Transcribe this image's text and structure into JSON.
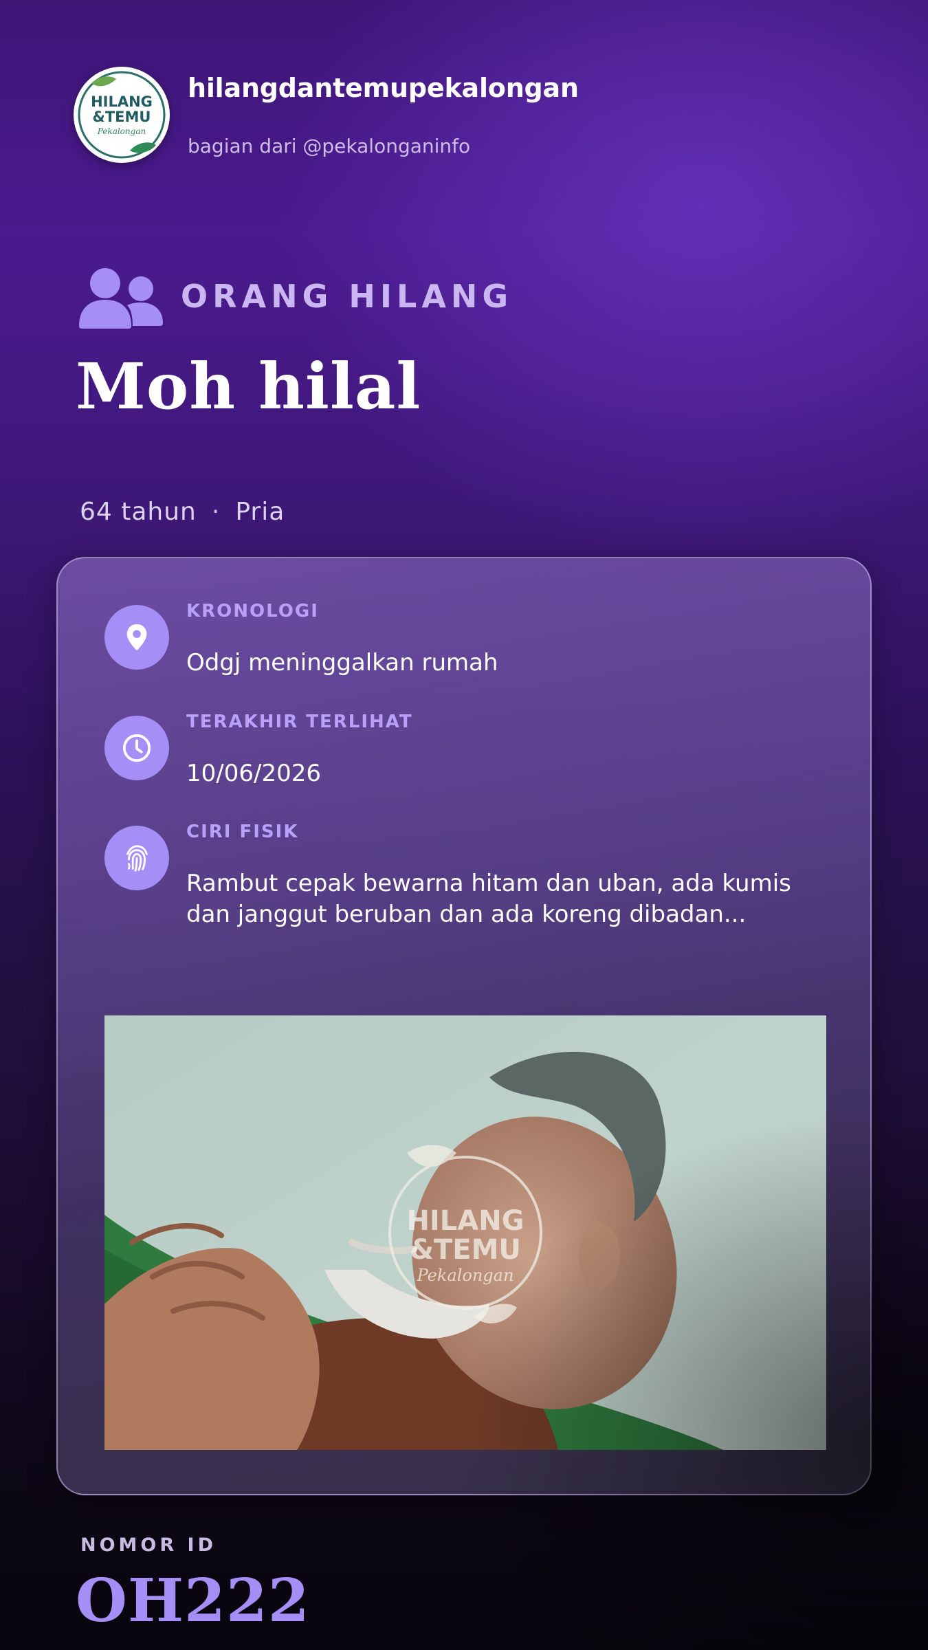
{
  "header": {
    "account_name": "hilangdantemupekalongan",
    "account_subtitle": "bagian dari @pekalonganinfo",
    "logo_text": [
      "HILANG",
      "&TEMU",
      "Pekalongan"
    ]
  },
  "category": {
    "icon": "people-icon",
    "label": "ORANG HILANG"
  },
  "person": {
    "name": "Moh hilal",
    "age": "64 tahun",
    "separator": "·",
    "gender": "Pria"
  },
  "details": [
    {
      "icon": "map-pin-icon",
      "label": "KRONOLOGI",
      "value": "Odgj meninggalkan rumah"
    },
    {
      "icon": "clock-icon",
      "label": "TERAKHIR TERLIHAT",
      "value": "10/06/2026"
    },
    {
      "icon": "fingerprint-icon",
      "label": "CIRI FISIK",
      "value": "Rambut cepak bewarna hitam dan uban, ada kumis dan janggut beruban dan ada koreng dibadan..."
    }
  ],
  "photo": {
    "watermark_text": [
      "HILANG",
      "&TEMU",
      "Pekalongan"
    ]
  },
  "id_section": {
    "label": "NOMOR ID",
    "value": "OH222"
  },
  "colors": {
    "accent": "#a68ef7",
    "background_top": "#4a1a8e",
    "background_bottom": "#07050d",
    "logo_green": "#2e8b57",
    "logo_teal": "#1f5c63"
  }
}
